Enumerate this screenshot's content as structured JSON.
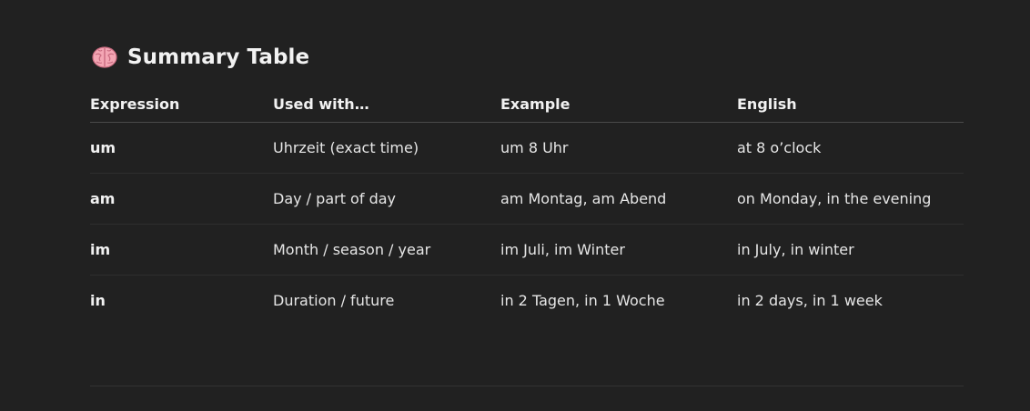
{
  "section": {
    "icon": "brain-icon",
    "title": "Summary Table"
  },
  "table": {
    "headers": [
      "Expression",
      "Used with…",
      "Example",
      "English"
    ],
    "rows": [
      [
        "um",
        "Uhrzeit (exact time)",
        "um 8 Uhr",
        "at 8 o’clock"
      ],
      [
        "am",
        "Day / part of day",
        "am Montag, am Abend",
        "on Monday, in the evening"
      ],
      [
        "im",
        "Month / season / year",
        "im Juli, im Winter",
        "in July, in winter"
      ],
      [
        "in",
        "Duration / future",
        "in 2 Tagen, in 1 Woche",
        "in 2 days, in 1 week"
      ]
    ]
  },
  "colors": {
    "background": "#212121",
    "text": "#ececec",
    "divider": "#4a4a4a",
    "brain_pink": "#f4a6b4"
  }
}
